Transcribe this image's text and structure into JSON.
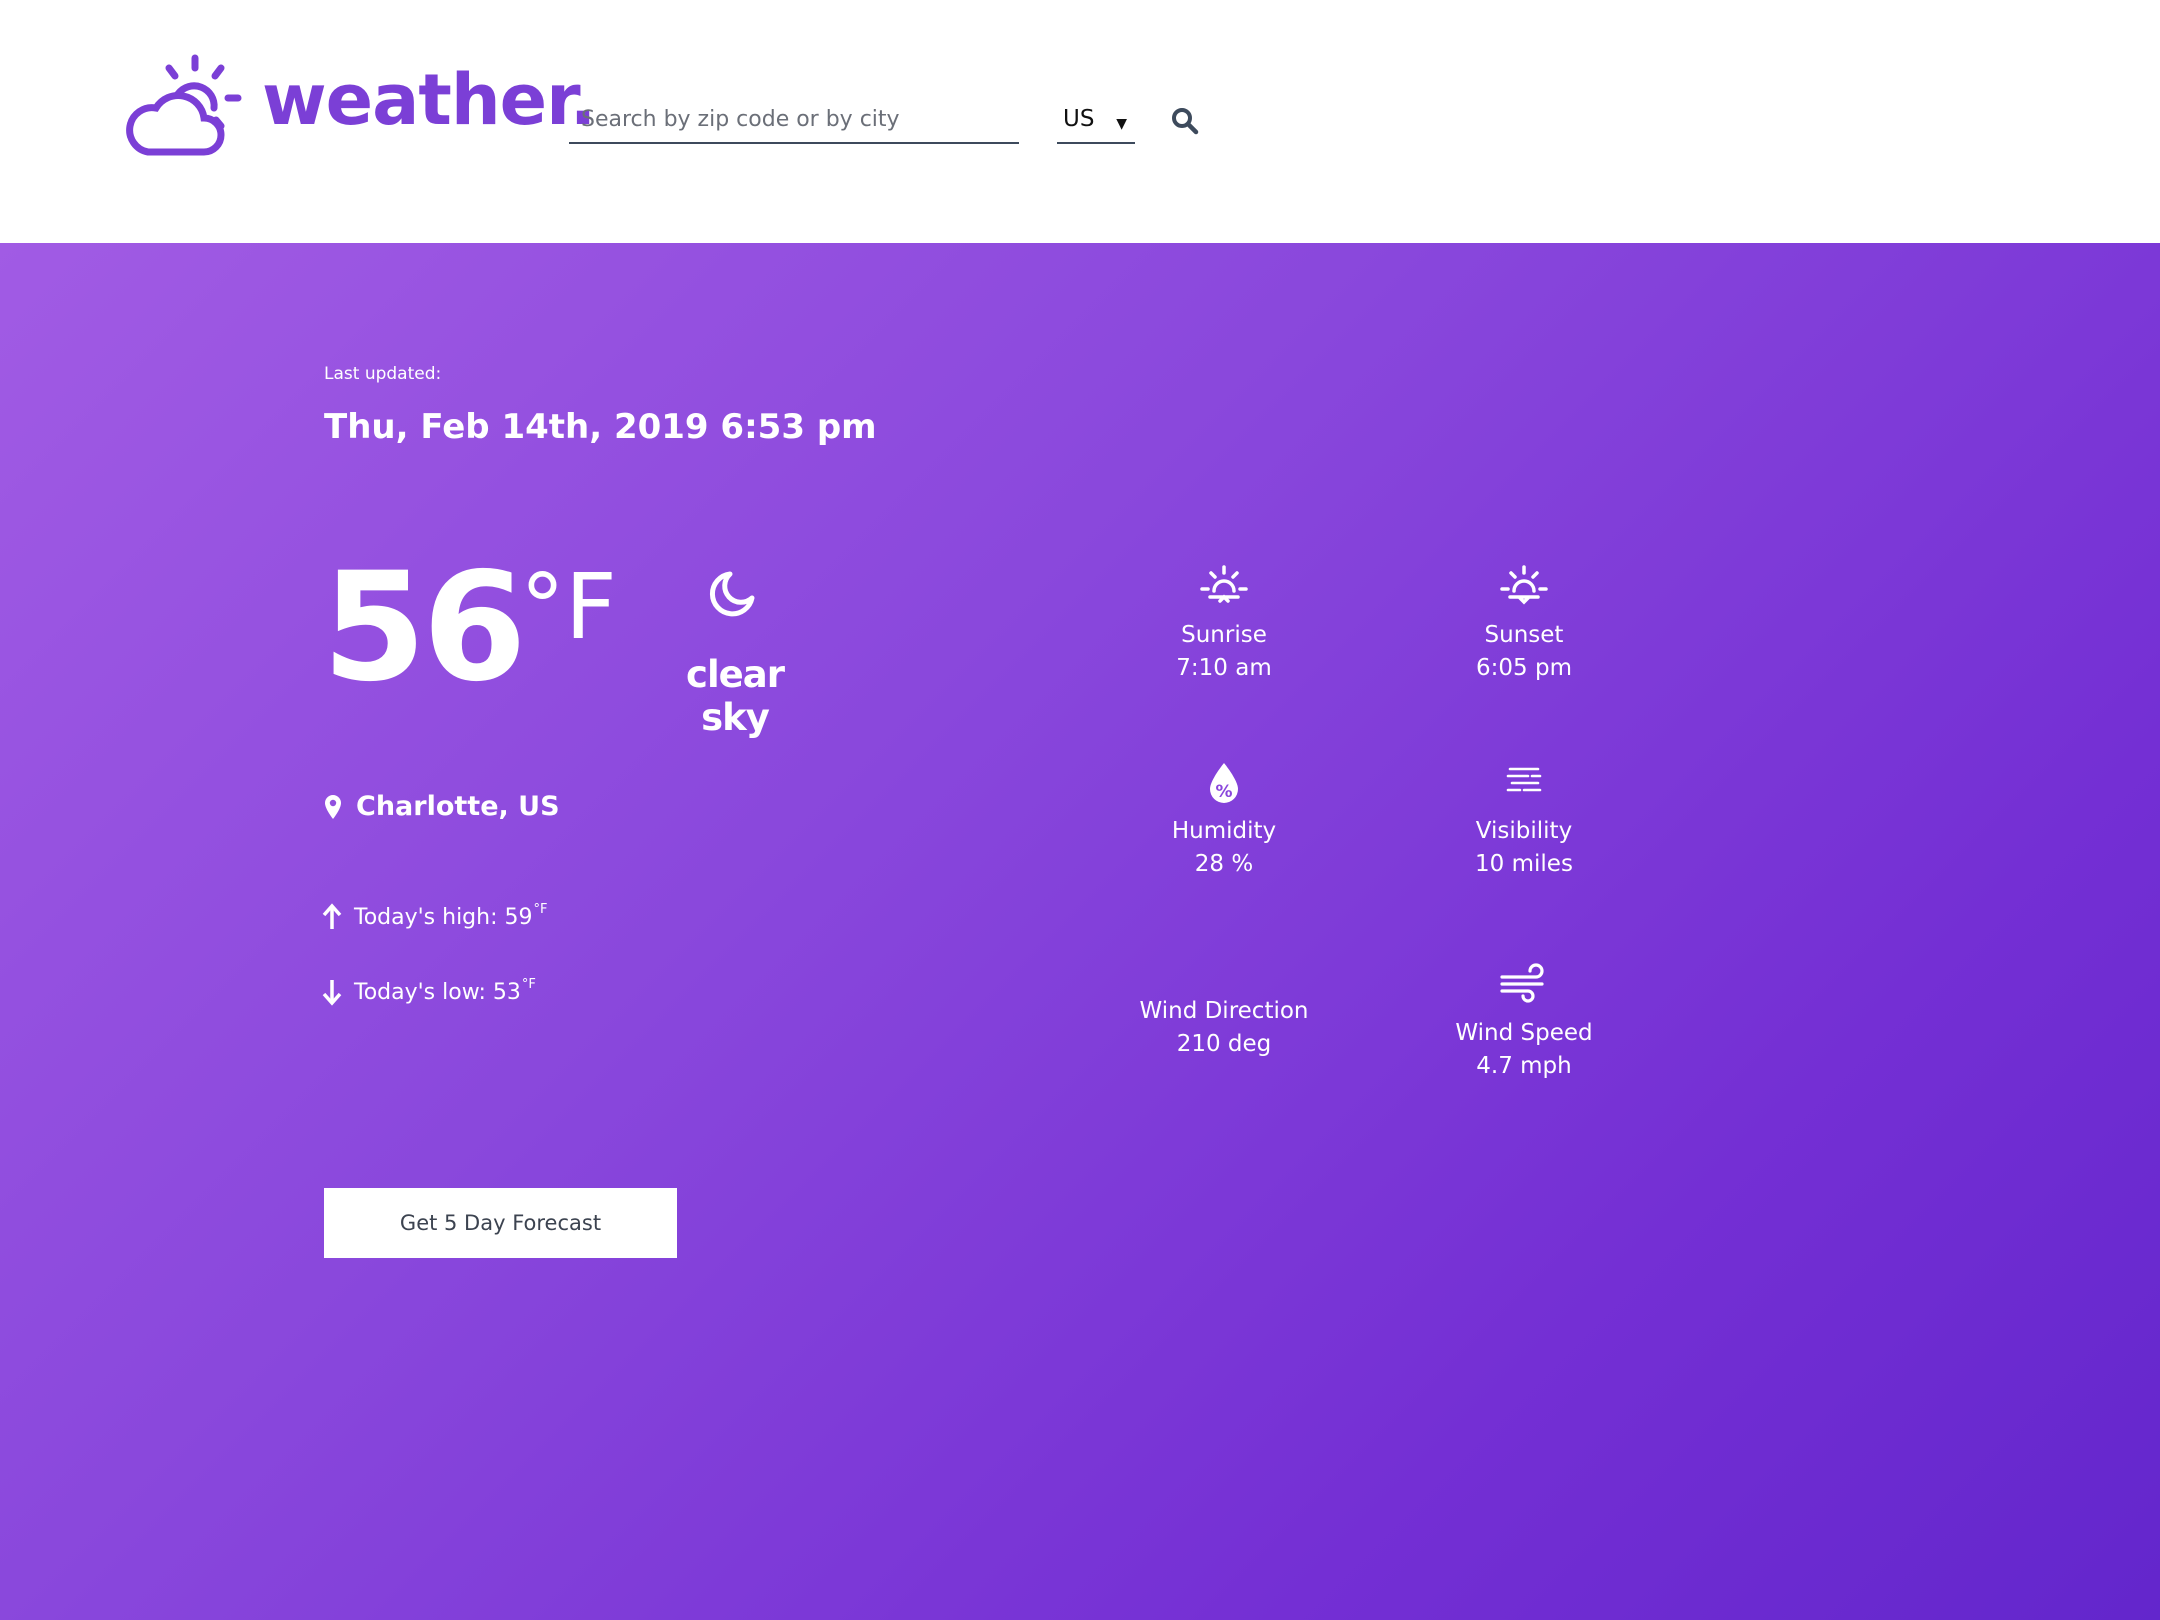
{
  "brand": {
    "name": "weather.",
    "color": "#7B3FD6",
    "logo_icon": "cloud-sun-icon"
  },
  "search": {
    "placeholder": "Search by zip code or by city",
    "value": ""
  },
  "country": {
    "selected": "US"
  },
  "search_button": {
    "icon": "search-icon"
  },
  "weather": {
    "last_updated_label": "Last updated:",
    "last_updated": "Thu, Feb 14th, 2019 6:53 pm",
    "temperature": "56",
    "temperature_unit": "°F",
    "condition": "clear sky",
    "condition_icon": "moon-icon",
    "location": "Charlotte, US",
    "high_label": "Today's high: 59",
    "high_unit": "°F",
    "low_label": "Today's low: 53",
    "low_unit": "°F"
  },
  "stats": {
    "sunrise": {
      "label": "Sunrise",
      "value": "7:10 am",
      "icon": "sunrise-icon"
    },
    "sunset": {
      "label": "Sunset",
      "value": "6:05 pm",
      "icon": "sunset-icon"
    },
    "humidity": {
      "label": "Humidity",
      "value": "28 %",
      "icon": "humidity-icon"
    },
    "visibility": {
      "label": "Visibility",
      "value": "10 miles",
      "icon": "fog-icon"
    },
    "wind_direction": {
      "label": "Wind Direction",
      "value": "210 deg"
    },
    "wind_speed": {
      "label": "Wind Speed",
      "value": "4.7 mph",
      "icon": "wind-icon"
    }
  },
  "forecast_button": {
    "label": "Get 5 Day Forecast"
  },
  "colors": {
    "gradient_start": "#A15BE4",
    "gradient_end": "#6326CC",
    "brand": "#7B3FD6"
  }
}
